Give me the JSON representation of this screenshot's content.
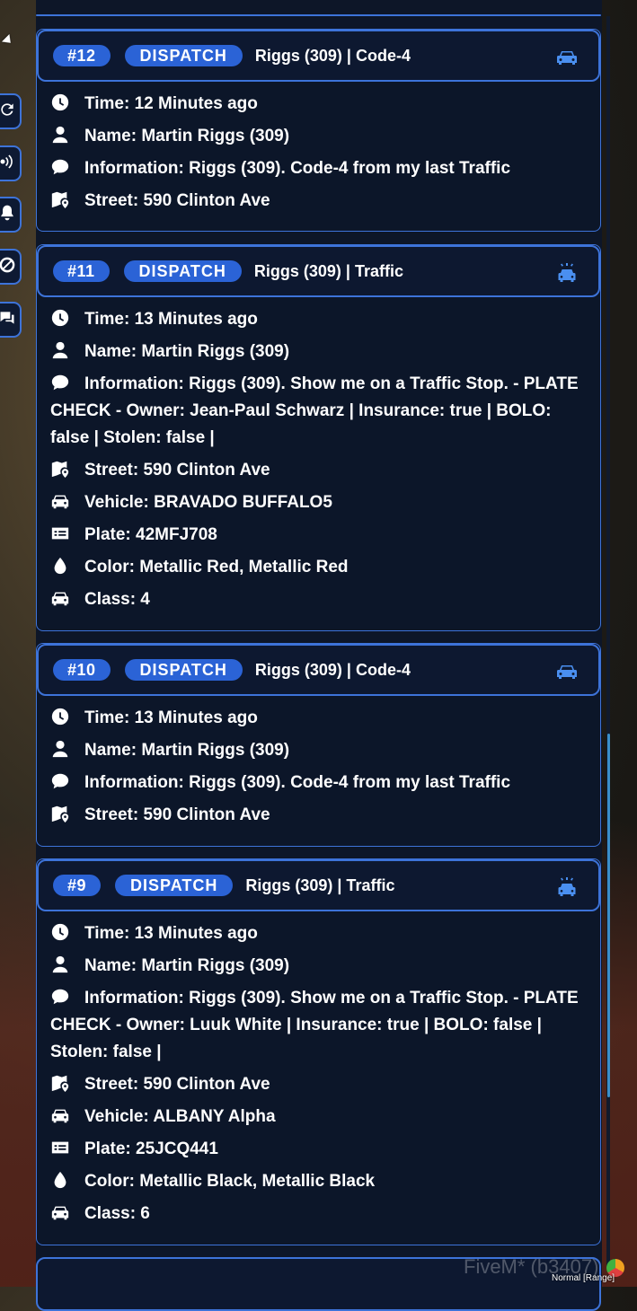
{
  "colors": {
    "accent": "#2b63d6",
    "border": "#3d73d9",
    "panel_bg": "#0c1629",
    "icon_blue": "#4a8ff0"
  },
  "sidebar": {
    "buttons": [
      {
        "icon": "refresh-icon"
      },
      {
        "icon": "broadcast-icon"
      },
      {
        "icon": "bell-icon"
      },
      {
        "icon": "block-icon"
      },
      {
        "icon": "chat-icon"
      }
    ]
  },
  "cards": [
    {
      "id": "#12",
      "type": "DISPATCH",
      "title": "Riggs (309) | Code-4",
      "head_icon": "car-icon",
      "rows": [
        {
          "icon": "clock-icon",
          "text": "Time: 12 Minutes ago"
        },
        {
          "icon": "user-icon",
          "text": "Name: Martin Riggs (309)"
        },
        {
          "icon": "message-icon",
          "text": "Information: Riggs (309). Code-4 from my last Traffic"
        },
        {
          "icon": "map-icon",
          "text": "Street: 590 Clinton Ave"
        }
      ]
    },
    {
      "id": "#11",
      "type": "DISPATCH",
      "title": "Riggs (309) | Traffic",
      "head_icon": "police-car-icon",
      "rows": [
        {
          "icon": "clock-icon",
          "text": "Time: 13 Minutes ago"
        },
        {
          "icon": "user-icon",
          "text": "Name: Martin Riggs (309)"
        },
        {
          "icon": "message-icon",
          "text": "Information: Riggs (309). Show me on a Traffic Stop. - PLATE CHECK - Owner: Jean-Paul Schwarz | Insurance: true | BOLO: false | Stolen: false |"
        },
        {
          "icon": "map-icon",
          "text": "Street: 590 Clinton Ave"
        },
        {
          "icon": "car-icon",
          "text": "Vehicle: BRAVADO BUFFALO5"
        },
        {
          "icon": "plate-icon",
          "text": "Plate: 42MFJ708"
        },
        {
          "icon": "droplet-icon",
          "text": "Color: Metallic Red, Metallic Red"
        },
        {
          "icon": "car-icon",
          "text": "Class: 4"
        }
      ]
    },
    {
      "id": "#10",
      "type": "DISPATCH",
      "title": "Riggs (309) | Code-4",
      "head_icon": "car-icon",
      "rows": [
        {
          "icon": "clock-icon",
          "text": "Time: 13 Minutes ago"
        },
        {
          "icon": "user-icon",
          "text": "Name: Martin Riggs (309)"
        },
        {
          "icon": "message-icon",
          "text": "Information: Riggs (309). Code-4 from my last Traffic"
        },
        {
          "icon": "map-icon",
          "text": "Street: 590 Clinton Ave"
        }
      ]
    },
    {
      "id": "#9",
      "type": "DISPATCH",
      "title": "Riggs (309) | Traffic",
      "head_icon": "police-car-icon",
      "rows": [
        {
          "icon": "clock-icon",
          "text": "Time: 13 Minutes ago"
        },
        {
          "icon": "user-icon",
          "text": "Name: Martin Riggs (309)"
        },
        {
          "icon": "message-icon",
          "text": "Information: Riggs (309). Show me on a Traffic Stop. - PLATE CHECK - Owner: Luuk White | Insurance: true | BOLO: false | Stolen: false |"
        },
        {
          "icon": "map-icon",
          "text": "Street: 590 Clinton Ave"
        },
        {
          "icon": "car-icon",
          "text": "Vehicle: ALBANY Alpha"
        },
        {
          "icon": "plate-icon",
          "text": "Plate: 25JCQ441"
        },
        {
          "icon": "droplet-icon",
          "text": "Color: Metallic Black, Metallic Black"
        },
        {
          "icon": "car-icon",
          "text": "Class: 6"
        }
      ]
    }
  ],
  "footer": {
    "watermark": "FiveM* (b3407)",
    "mode": "Normal [Range]"
  }
}
